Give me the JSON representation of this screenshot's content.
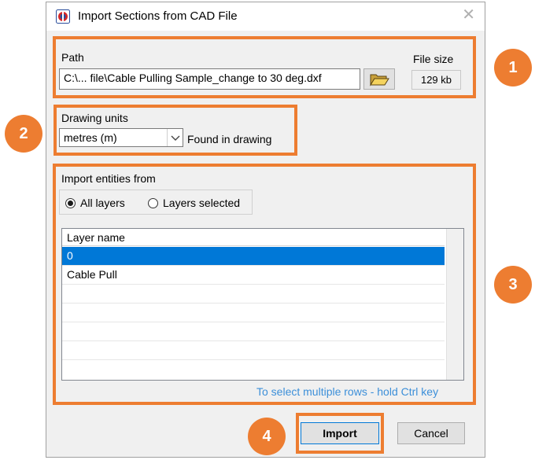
{
  "window": {
    "title": "Import Sections from CAD File",
    "close_glyph": "✕"
  },
  "path_section": {
    "label": "Path",
    "value": "C:\\... file\\Cable Pulling Sample_change to 30 deg.dxf",
    "browse_icon": "folder-open-icon",
    "file_size_label": "File size",
    "file_size_value": "129 kb"
  },
  "units_section": {
    "label": "Drawing units",
    "selected": "metres (m)",
    "status": "Found in drawing"
  },
  "entities_section": {
    "label": "Import entities from",
    "options": [
      {
        "label": "All layers",
        "checked": true
      },
      {
        "label": "Layers selected",
        "checked": false
      }
    ],
    "table": {
      "column_header": "Layer name",
      "rows": [
        "0",
        "Cable Pull"
      ],
      "selected_row": 0
    },
    "hint": "To select multiple rows - hold Ctrl key"
  },
  "footer": {
    "import_label": "Import",
    "cancel_label": "Cancel"
  },
  "annotations": [
    "1",
    "2",
    "3",
    "4"
  ],
  "colors": {
    "accent": "#ed7d31",
    "selection": "#0078d7",
    "hint": "#3c8fd9"
  }
}
